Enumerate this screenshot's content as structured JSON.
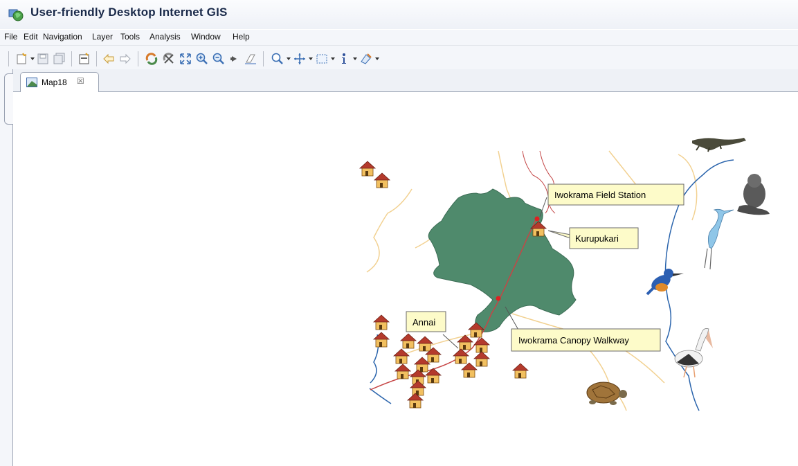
{
  "window": {
    "title": "User-friendly Desktop Internet GIS"
  },
  "menu": {
    "items": [
      "File",
      "Edit",
      "Navigation",
      "Layer",
      "Tools",
      "Analysis",
      "Window",
      "Help"
    ]
  },
  "editor": {
    "tab_label": "Map18",
    "tab_close": "☒"
  },
  "map": {
    "labels": {
      "field_station": "Iwokrama Field Station",
      "kurupukari": "Kurupukari",
      "annai": "Annai",
      "canopy_walkway": "Iwokrama Canopy Walkway"
    },
    "colors": {
      "reserve": "#4f8a6c",
      "road": "#c64545",
      "river": "#2a64ac",
      "trail": "#f0cd88",
      "callout": "#fdfbc9"
    }
  }
}
